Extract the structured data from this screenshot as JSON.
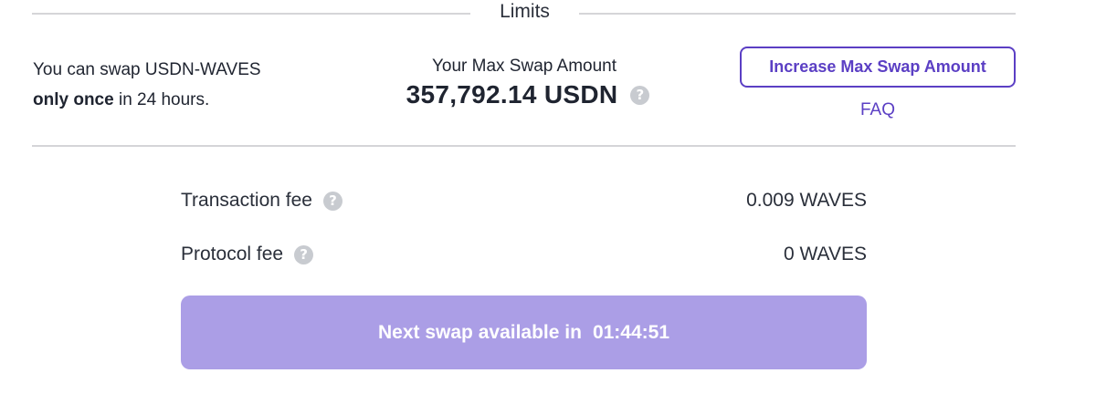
{
  "limits": {
    "title": "Limits"
  },
  "swap_info": {
    "line1": "You can swap USDN-WAVES",
    "emphasis": "only once",
    "line2_rest": " in 24 hours."
  },
  "max_swap": {
    "label": "Your Max Swap Amount",
    "value": "357,792.14 USDN",
    "help_icon": "question-circle-icon"
  },
  "actions": {
    "increase_label": "Increase Max Swap Amount",
    "faq_label": "FAQ"
  },
  "fees": {
    "transaction_label": "Transaction fee",
    "transaction_value": "0.009 WAVES",
    "protocol_label": "Protocol fee",
    "protocol_value": "0 WAVES"
  },
  "next_swap": {
    "label": "Next swap available in",
    "countdown": "01:44:51"
  },
  "colors": {
    "accent": "#5b3fc4",
    "disabled_button": "#ab9ee6",
    "divider": "#d5d5d8",
    "help_icon": "#c8cbd0"
  }
}
